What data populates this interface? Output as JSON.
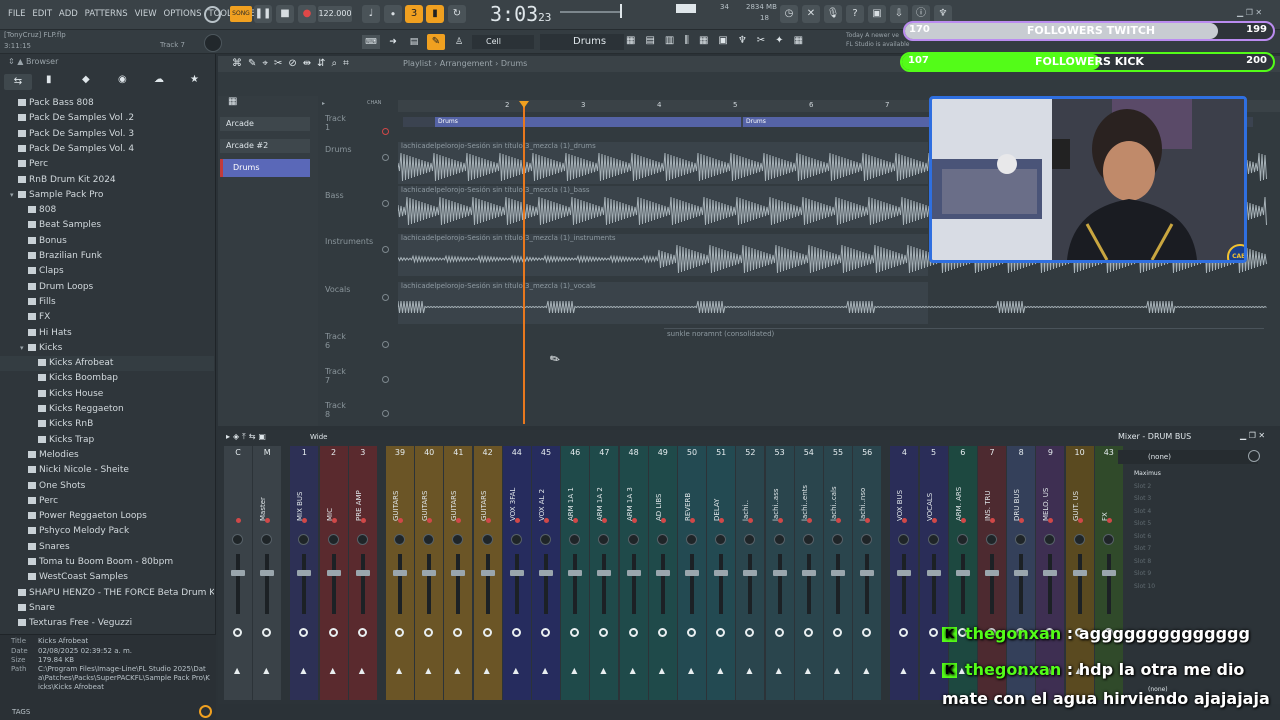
{
  "menu": [
    "FILE",
    "EDIT",
    "ADD",
    "PATTERNS",
    "VIEW",
    "OPTIONS",
    "TOOLS",
    "HELP"
  ],
  "transport": {
    "song_label": "SONG",
    "tempo": "122.000",
    "time": "3:03",
    "time_ticks": "23",
    "cpu": "34",
    "ram": "2834 MB",
    "ram_num": "18"
  },
  "hint": {
    "today": "Today",
    "line1": "A newer ve",
    "line2": "FL Studio is available"
  },
  "project": {
    "user": "[TonyCruz]",
    "file": "FLP.flp",
    "time": "3:11:15",
    "track_hint": "Track 7"
  },
  "toolbar2": {
    "cell": "Cell",
    "pattern": "Drums"
  },
  "browser": {
    "title": "Browser",
    "items": [
      {
        "label": "Pack Bass 808",
        "depth": 1
      },
      {
        "label": "Pack De Samples Vol .2",
        "depth": 1
      },
      {
        "label": "Pack De Samples Vol. 3",
        "depth": 1
      },
      {
        "label": "Pack De Samples Vol. 4",
        "depth": 1
      },
      {
        "label": "Perc",
        "depth": 1
      },
      {
        "label": "RnB Drum Kit 2024",
        "depth": 1
      },
      {
        "label": "Sample Pack Pro",
        "depth": 1,
        "open": true
      },
      {
        "label": "808",
        "depth": 2
      },
      {
        "label": "Beat Samples",
        "depth": 2
      },
      {
        "label": "Bonus",
        "depth": 2
      },
      {
        "label": "Brazilian Funk",
        "depth": 2
      },
      {
        "label": "Claps",
        "depth": 2
      },
      {
        "label": "Drum Loops",
        "depth": 2
      },
      {
        "label": "Fills",
        "depth": 2
      },
      {
        "label": "FX",
        "depth": 2
      },
      {
        "label": "Hi Hats",
        "depth": 2
      },
      {
        "label": "Kicks",
        "depth": 2,
        "open": true
      },
      {
        "label": "Kicks Afrobeat",
        "depth": 3
      },
      {
        "label": "Kicks Boombap",
        "depth": 3
      },
      {
        "label": "Kicks House",
        "depth": 3
      },
      {
        "label": "Kicks Reggaeton",
        "depth": 3
      },
      {
        "label": "Kicks RnB",
        "depth": 3
      },
      {
        "label": "Kicks Trap",
        "depth": 3
      },
      {
        "label": "Melodies",
        "depth": 2
      },
      {
        "label": "Nicki Nicole - Sheite",
        "depth": 2
      },
      {
        "label": "One Shots",
        "depth": 2
      },
      {
        "label": "Perc",
        "depth": 2
      },
      {
        "label": "Power Reggaeton Loops",
        "depth": 2
      },
      {
        "label": "Pshyco Melody Pack",
        "depth": 2
      },
      {
        "label": "Snares",
        "depth": 2
      },
      {
        "label": "Toma tu Boom Boom - 80bpm",
        "depth": 2
      },
      {
        "label": "WestCoast Samples",
        "depth": 2
      },
      {
        "label": "SHAPU HENZO - THE FORCE Beta Drum Kit",
        "depth": 1
      },
      {
        "label": "Snare",
        "depth": 1
      },
      {
        "label": "Texturas Free - Veguzzi",
        "depth": 1
      }
    ],
    "info": {
      "title_key": "Title",
      "title": "Kicks Afrobeat",
      "date_key": "Date",
      "date": "02/08/2025 02:39:52 a. m.",
      "size_key": "Size",
      "size": "179.84 KB",
      "path_key": "Path",
      "path": "C:\\Program Files\\Image-Line\\FL Studio 2025\\Data\\Patches\\Packs\\SuperPACKFL\\Sample Pack Pro\\Kicks\\Kicks Afrobeat"
    },
    "tags": "TAGS"
  },
  "playlist": {
    "breadcrumb": [
      "Playlist",
      "Arrangement",
      "Drums"
    ],
    "patterns": [
      "Arcade",
      "Arcade #2",
      "Drums"
    ],
    "ruler": [
      "2",
      "3",
      "4",
      "5",
      "6",
      "7",
      "8"
    ],
    "tracks": [
      "Track 1",
      "Drums",
      "Bass",
      "Instruments",
      "Vocals",
      "Track 6",
      "Track 7",
      "Track 8"
    ],
    "pattern_clip": "Drums",
    "clips": [
      "lachicadelpelorojo-Sesión sin título 3_mezcla (1)_drums",
      "lachicadelpelorojo-Sesión sin título 3_mezcla (1)_bass",
      "lachicadelpelorojo-Sesión sin título 3_mezcla (1)_instruments",
      "lachicadelpelorojo-Sesión sin título 3_mezcla (1)_vocals",
      "sunkle noramnt (consolidated)"
    ],
    "channel_header": "CHAN"
  },
  "mixer": {
    "title": "Mixer - DRUM BUS",
    "view": "Wide",
    "insert_preset": "(none)",
    "slots": [
      "Maximus",
      "Slot 2",
      "Slot 3",
      "Slot 4",
      "Slot 5",
      "Slot 6",
      "Slot 7",
      "Slot 8",
      "Slot 9",
      "Slot 10"
    ],
    "bottom_slot": "(none)",
    "strips": [
      {
        "num": "C",
        "name": "",
        "color": "#3a4248"
      },
      {
        "num": "M",
        "name": "Master",
        "color": "#3a4248"
      },
      {
        "num": "1",
        "name": "MIX BUS",
        "color": "#2d3055"
      },
      {
        "num": "2",
        "name": "MIC",
        "color": "#5a2a2e"
      },
      {
        "num": "3",
        "name": "PRE AMP",
        "color": "#5a2a2e"
      },
      {
        "num": "39",
        "name": "GUITARS",
        "color": "#6b5526"
      },
      {
        "num": "40",
        "name": "GUITARS",
        "color": "#6b5526"
      },
      {
        "num": "41",
        "name": "GUITARS",
        "color": "#6b5526"
      },
      {
        "num": "42",
        "name": "GUITARS",
        "color": "#6b5526"
      },
      {
        "num": "44",
        "name": "VOX 3FAL",
        "color": "#262c5e"
      },
      {
        "num": "45",
        "name": "VOX AL 2",
        "color": "#262c5e"
      },
      {
        "num": "46",
        "name": "ARM 1A 1",
        "color": "#1f4a4a"
      },
      {
        "num": "47",
        "name": "ARM 1A 2",
        "color": "#1f4a4a"
      },
      {
        "num": "48",
        "name": "ARM 1A 3",
        "color": "#1f4a4a"
      },
      {
        "num": "49",
        "name": "AD LIBS",
        "color": "#1f4a4a"
      },
      {
        "num": "50",
        "name": "REVERB",
        "color": "#234a52"
      },
      {
        "num": "51",
        "name": "DELAY",
        "color": "#234a52"
      },
      {
        "num": "52",
        "name": "lachi..",
        "color": "#2a454d"
      },
      {
        "num": "53",
        "name": "lachi..ass",
        "color": "#2a454d"
      },
      {
        "num": "54",
        "name": "lachi..ents",
        "color": "#2a454d"
      },
      {
        "num": "55",
        "name": "lachi..cals",
        "color": "#2a454d"
      },
      {
        "num": "56",
        "name": "lachi..nso",
        "color": "#2a454d"
      },
      {
        "num": "4",
        "name": "VOX BUS",
        "color": "#2a2d58"
      },
      {
        "num": "5",
        "name": "VOCALS",
        "color": "#2a2d58"
      },
      {
        "num": "6",
        "name": "ARM. ARS",
        "color": "#1d4840"
      },
      {
        "num": "7",
        "name": "INS. TRU",
        "color": "#4d2a30"
      },
      {
        "num": "8",
        "name": "DRU BUS",
        "color": "#34405a"
      },
      {
        "num": "9",
        "name": "MELO. US",
        "color": "#3e2f52"
      },
      {
        "num": "10",
        "name": "GUIT. US",
        "color": "#5a4a20"
      },
      {
        "num": "43",
        "name": "FX",
        "color": "#304a2a"
      }
    ]
  },
  "stream": {
    "twitch_left": "170",
    "twitch_label": "FOLLOWERS TWITCH",
    "twitch_right": "199",
    "twitch_progress": 0.85,
    "kick_left": "107",
    "kick_label": "FOLLOWERS KICK",
    "kick_right": "200",
    "kick_progress": 0.535,
    "badge": "CABJ",
    "chat": [
      {
        "user": "thegonxan",
        "text": "agggggggggggggg"
      },
      {
        "user": "thegonxan",
        "text": "hdp la otra me dio"
      },
      {
        "user": "",
        "text": "mate con el agua hirviendo ajajajaja"
      }
    ]
  },
  "colors": {
    "accent_orange": "#f0a020",
    "playhead": "#e8781e",
    "kick_green": "#53fc18",
    "twitch_purple": "#bb8cf0",
    "webcam_border": "#2f6fe0"
  }
}
